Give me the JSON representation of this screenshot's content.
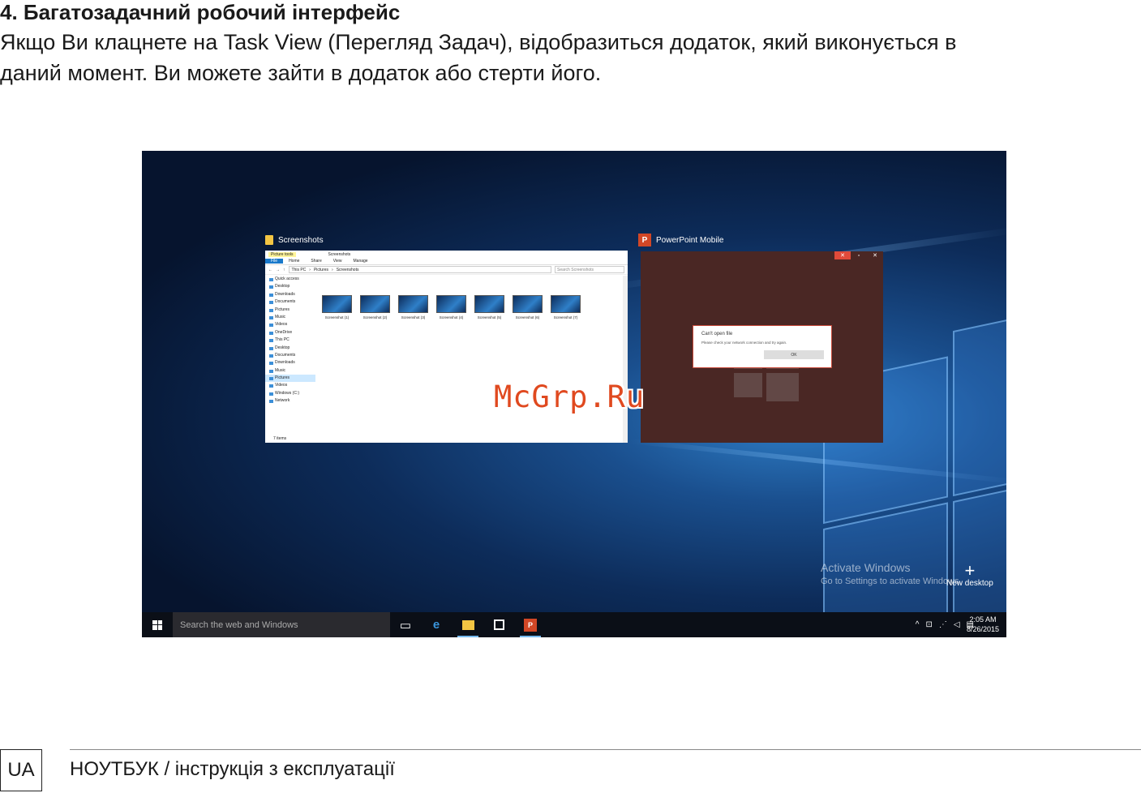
{
  "heading": "4. Багатозадачний робочий інтерфейс",
  "paragraph_line1": "Якщо Ви клацнете на Task View (Перегляд Задач), відобразиться додаток, який виконується в",
  "paragraph_line2": "даний момент. Ви можете зайти в додаток або стерти його.",
  "screenshot": {
    "explorer": {
      "window_label": "Screenshots",
      "title_tools": "Picture tools",
      "title_text": "Screenshots",
      "ribbon": [
        "File",
        "Home",
        "Share",
        "View",
        "Manage"
      ],
      "address": [
        "This PC",
        "Pictures",
        "Screenshots"
      ],
      "search_placeholder": "Search Screenshots",
      "nav": [
        "Quick access",
        "Desktop",
        "Downloads",
        "Documents",
        "Pictures",
        "Music",
        "Videos",
        "OneDrive",
        "This PC",
        "Desktop",
        "Documents",
        "Downloads",
        "Music",
        "Pictures",
        "Videos",
        "Windows (C:)",
        "Network"
      ],
      "files": [
        "Screenshot (1)",
        "Screenshot (2)",
        "Screenshot (3)",
        "Screenshot (4)",
        "Screenshot (5)",
        "Screenshot (6)",
        "Screenshot (7)"
      ],
      "status": "7 items"
    },
    "ppt": {
      "window_label": "PowerPoint Mobile",
      "icon_letter": "P",
      "dialog_title": "Can't open file",
      "dialog_message": "Please check your network connection and try again.",
      "dialog_ok": "OK"
    },
    "watermark": "McGrp.Ru",
    "activate_title": "Activate Windows",
    "activate_sub": "Go to Settings to activate Windows.",
    "new_desktop": "New desktop",
    "taskbar": {
      "search_placeholder": "Search the web and Windows",
      "time": "2:05 AM",
      "date": "8/26/2015"
    }
  },
  "footer": {
    "lang": "UA",
    "text": "НОУТБУК / інструкція з експлуатації"
  }
}
